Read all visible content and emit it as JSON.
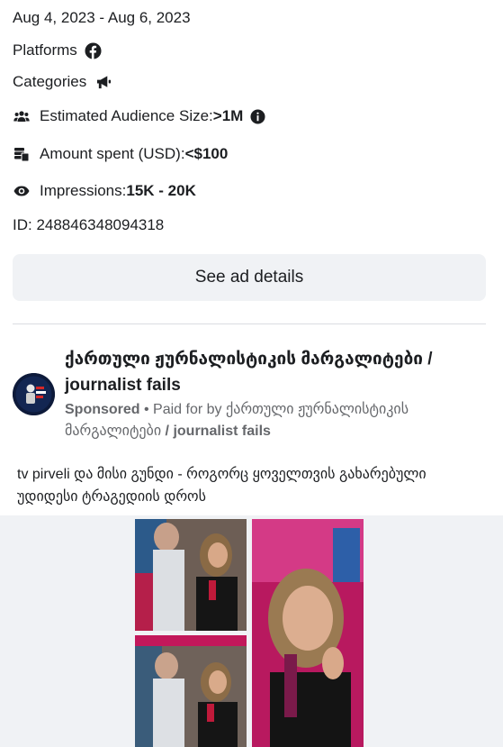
{
  "dates": "Aug 4, 2023 - Aug 6, 2023",
  "platforms_label": "Platforms",
  "categories_label": "Categories",
  "audience": {
    "label": "Estimated Audience Size:",
    "value": ">1M"
  },
  "amount": {
    "label": "Amount spent (USD): ",
    "value": "<$100"
  },
  "impressions": {
    "label": "Impressions: ",
    "value": "15K - 20K"
  },
  "ad_id": "ID: 248846348094318",
  "see_details": "See ad details",
  "page": {
    "name": "ქართული ჟურნალისტიკის მარგალიტები / journalist fails",
    "sponsored": "Sponsored",
    "paid_prefix": " • Paid for by ",
    "paid_by_1": "ქართული ჟურნალისტიკის მარგალიტები",
    "paid_by_2": " / journalist fails"
  },
  "ad_text": "tv pirveli და მისი გუნდი - როგორც ყოველთვის გახარებული უდიდესი ტრაგედიის დროს",
  "colors": {
    "text": "#1c1e21",
    "secondary": "#65676b",
    "button_bg": "#f0f2f5",
    "divider": "#dadde1"
  },
  "icons": [
    "facebook-icon",
    "megaphone-icon",
    "audience-icon",
    "info-icon",
    "money-icon",
    "eye-icon"
  ]
}
